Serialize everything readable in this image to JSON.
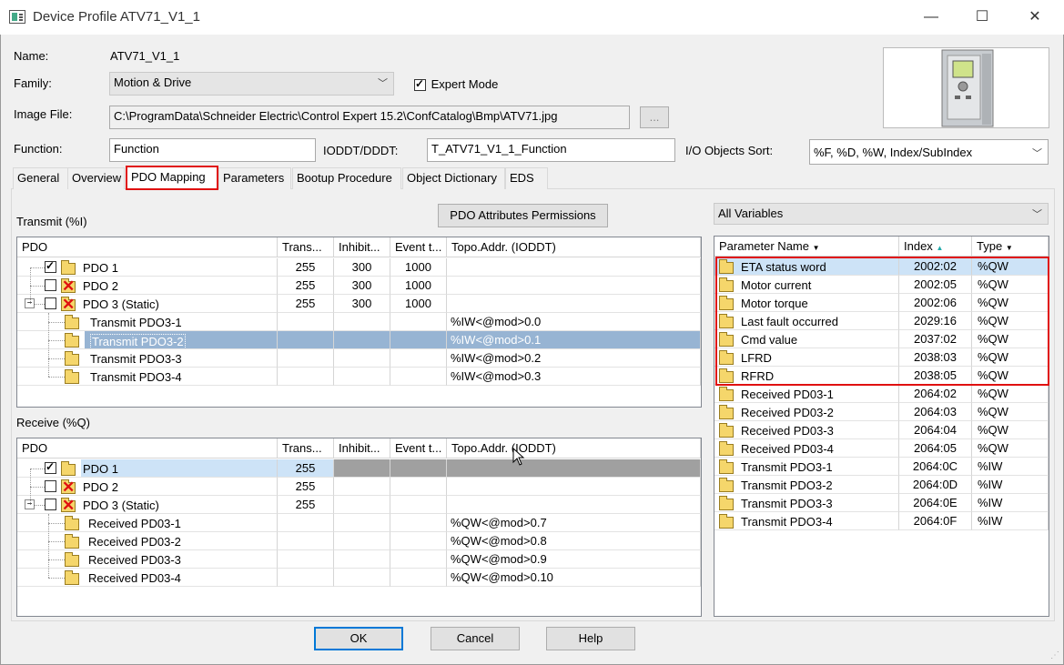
{
  "window": {
    "title": "Device Profile ATV71_V1_1",
    "minimize": "—",
    "maximize": "☐",
    "close": "✕"
  },
  "form": {
    "name_label": "Name:",
    "name_value": "ATV71_V1_1",
    "family_label": "Family:",
    "family_value": "Motion & Drive",
    "expert_mode_label": "Expert Mode",
    "expert_mode_checked": true,
    "image_file_label": "Image File:",
    "image_file_value": "C:\\ProgramData\\Schneider Electric\\Control Expert 15.2\\ConfCatalog\\Bmp\\ATV71.jpg",
    "browse_label": "...",
    "function_label": "Function:",
    "function_value": "Function",
    "ioddt_label": "IODDT/DDDT:",
    "ioddt_value": "T_ATV71_V1_1_Function",
    "sort_label": "I/O Objects Sort:",
    "sort_value": "%F, %D, %W, Index/SubIndex"
  },
  "tabs": [
    "General",
    "Overview",
    "PDO Mapping",
    "Parameters",
    "Bootup Procedure",
    "Object Dictionary",
    "EDS"
  ],
  "active_tab": "PDO Mapping",
  "pdo_attr_button": "PDO Attributes Permissions",
  "transmit": {
    "label": "Transmit (%I)",
    "columns": [
      "PDO",
      "Trans...",
      "Inhibit...",
      "Event t...",
      "Topo.Addr. (IODDT)"
    ],
    "rows": [
      {
        "name": "PDO 1",
        "trans": "255",
        "inhibit": "300",
        "event": "1000",
        "topo": ""
      },
      {
        "name": "PDO 2",
        "trans": "255",
        "inhibit": "300",
        "event": "1000",
        "topo": ""
      },
      {
        "name": "PDO 3 (Static)",
        "trans": "255",
        "inhibit": "300",
        "event": "1000",
        "topo": ""
      },
      {
        "name": "Transmit PDO3-1",
        "trans": "",
        "inhibit": "",
        "event": "",
        "topo": "%IW<@mod>0.0"
      },
      {
        "name": "Transmit PDO3-2",
        "trans": "",
        "inhibit": "",
        "event": "",
        "topo": "%IW<@mod>0.1"
      },
      {
        "name": "Transmit PDO3-3",
        "trans": "",
        "inhibit": "",
        "event": "",
        "topo": "%IW<@mod>0.2"
      },
      {
        "name": "Transmit PDO3-4",
        "trans": "",
        "inhibit": "",
        "event": "",
        "topo": "%IW<@mod>0.3"
      }
    ]
  },
  "receive": {
    "label": "Receive (%Q)",
    "columns": [
      "PDO",
      "Trans...",
      "Inhibit...",
      "Event t...",
      "Topo.Addr. (IODDT)"
    ],
    "rows": [
      {
        "name": "PDO 1",
        "trans": "255",
        "topo": ""
      },
      {
        "name": "PDO 2",
        "trans": "255",
        "topo": ""
      },
      {
        "name": "PDO 3 (Static)",
        "trans": "255",
        "topo": ""
      },
      {
        "name": "Received PD03-1",
        "trans": "",
        "topo": "%QW<@mod>0.7"
      },
      {
        "name": "Received PD03-2",
        "trans": "",
        "topo": "%QW<@mod>0.8"
      },
      {
        "name": "Received PD03-3",
        "trans": "",
        "topo": "%QW<@mod>0.9"
      },
      {
        "name": "Received PD03-4",
        "trans": "",
        "topo": "%QW<@mod>0.10"
      }
    ]
  },
  "variables": {
    "filter": "All Variables",
    "columns": [
      "Parameter Name",
      "Index",
      "Type"
    ],
    "rows": [
      {
        "name": "ETA status word",
        "index": "2002:02",
        "type": "%QW"
      },
      {
        "name": "Motor current",
        "index": "2002:05",
        "type": "%QW"
      },
      {
        "name": "Motor torque",
        "index": "2002:06",
        "type": "%QW"
      },
      {
        "name": "Last fault occurred",
        "index": "2029:16",
        "type": "%QW"
      },
      {
        "name": "Cmd value",
        "index": "2037:02",
        "type": "%QW"
      },
      {
        "name": "LFRD",
        "index": "2038:03",
        "type": "%QW"
      },
      {
        "name": "RFRD",
        "index": "2038:05",
        "type": "%QW"
      },
      {
        "name": "Received PD03-1",
        "index": "2064:02",
        "type": "%QW"
      },
      {
        "name": "Received PD03-2",
        "index": "2064:03",
        "type": "%QW"
      },
      {
        "name": "Received PD03-3",
        "index": "2064:04",
        "type": "%QW"
      },
      {
        "name": "Received PD03-4",
        "index": "2064:05",
        "type": "%QW"
      },
      {
        "name": "Transmit PDO3-1",
        "index": "2064:0C",
        "type": "%IW"
      },
      {
        "name": "Transmit PDO3-2",
        "index": "2064:0D",
        "type": "%IW"
      },
      {
        "name": "Transmit PDO3-3",
        "index": "2064:0E",
        "type": "%IW"
      },
      {
        "name": "Transmit PDO3-4",
        "index": "2064:0F",
        "type": "%IW"
      }
    ]
  },
  "buttons": {
    "ok": "OK",
    "cancel": "Cancel",
    "help": "Help"
  },
  "colors": {
    "highlight": "#e01010",
    "selection": "#cde3f7",
    "selection_strong": "#97b4d3"
  }
}
